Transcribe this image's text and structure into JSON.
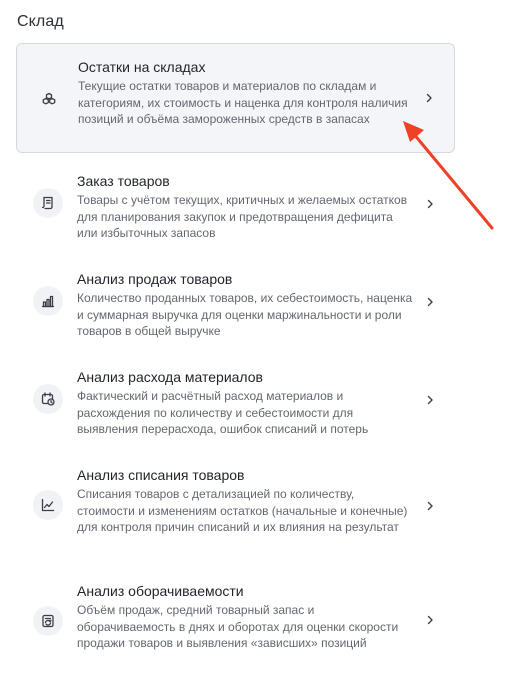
{
  "section": {
    "title": "Склад"
  },
  "items": [
    {
      "title": "Остатки на складах",
      "description": "Текущие остатки товаров и материалов по складам и категориям, их стоимость и наценка для контроля наличия позиций и объёма замороженных средств в запасах",
      "icon": "boxes-icon",
      "selected": true
    },
    {
      "title": "Заказ товаров",
      "description": "Товары с учётом текущих, критичных и желаемых остатков для планирования закупок и предотвращения дефицита или избыточных запасов",
      "icon": "order-list-icon",
      "selected": false
    },
    {
      "title": "Анализ продаж товаров",
      "description": "Количество проданных товаров, их себестоимость, наценка и суммарная выручка для оценки маржинальности и роли товаров в общей выручке",
      "icon": "bar-chart-icon",
      "selected": false
    },
    {
      "title": "Анализ расхода материалов",
      "description": "Фактический и расчётный расход материалов и расхождения по количеству и себестоимости для выявления перерасхода, ошибок списаний и потерь",
      "icon": "material-usage-icon",
      "selected": false
    },
    {
      "title": "Анализ списания товаров",
      "description": "Списания товаров с детализацией по количеству, стоимости и изменениям остатков (начальные и конечные) для контроля причин списаний и их влияния на результат",
      "icon": "line-chart-icon",
      "selected": false
    },
    {
      "title": "Анализ оборачиваемости",
      "description": "Объём продаж, средний товарный запас и оборачиваемость в днях и оборотах для оценки скорости продажи товаров и выявления «зависших» позиций",
      "icon": "turnover-icon",
      "selected": false
    }
  ],
  "colors": {
    "annotation_arrow": "#ee4126",
    "selected_bg": "#f4f5f9",
    "icon": "#3a3f47"
  }
}
